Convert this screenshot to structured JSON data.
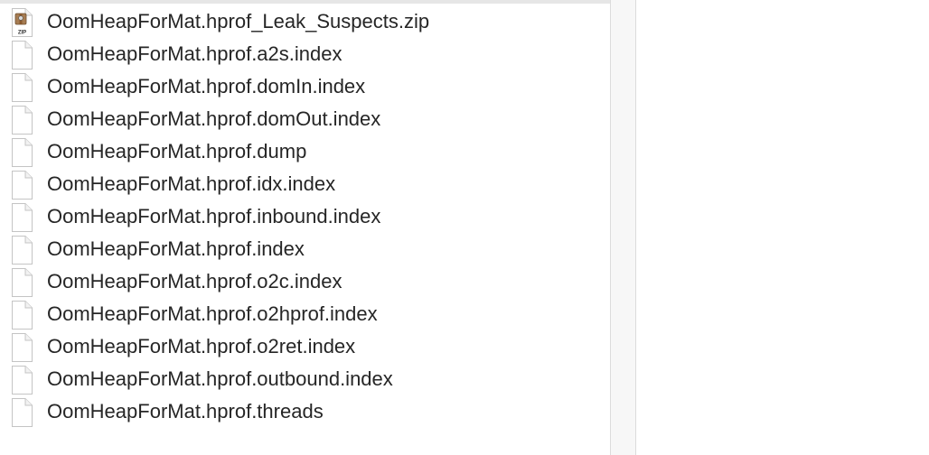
{
  "files": [
    {
      "name": "OomHeapForMat.hprof_Leak_Suspects.zip",
      "icon": "zip-archive-icon",
      "icon_label": "ZIP"
    },
    {
      "name": "OomHeapForMat.hprof.a2s.index",
      "icon": "document-icon"
    },
    {
      "name": "OomHeapForMat.hprof.domIn.index",
      "icon": "document-icon"
    },
    {
      "name": "OomHeapForMat.hprof.domOut.index",
      "icon": "document-icon"
    },
    {
      "name": "OomHeapForMat.hprof.dump",
      "icon": "document-icon"
    },
    {
      "name": "OomHeapForMat.hprof.idx.index",
      "icon": "document-icon"
    },
    {
      "name": "OomHeapForMat.hprof.inbound.index",
      "icon": "document-icon"
    },
    {
      "name": "OomHeapForMat.hprof.index",
      "icon": "document-icon"
    },
    {
      "name": "OomHeapForMat.hprof.o2c.index",
      "icon": "document-icon"
    },
    {
      "name": "OomHeapForMat.hprof.o2hprof.index",
      "icon": "document-icon"
    },
    {
      "name": "OomHeapForMat.hprof.o2ret.index",
      "icon": "document-icon"
    },
    {
      "name": "OomHeapForMat.hprof.outbound.index",
      "icon": "document-icon"
    },
    {
      "name": "OomHeapForMat.hprof.threads",
      "icon": "document-icon"
    }
  ]
}
